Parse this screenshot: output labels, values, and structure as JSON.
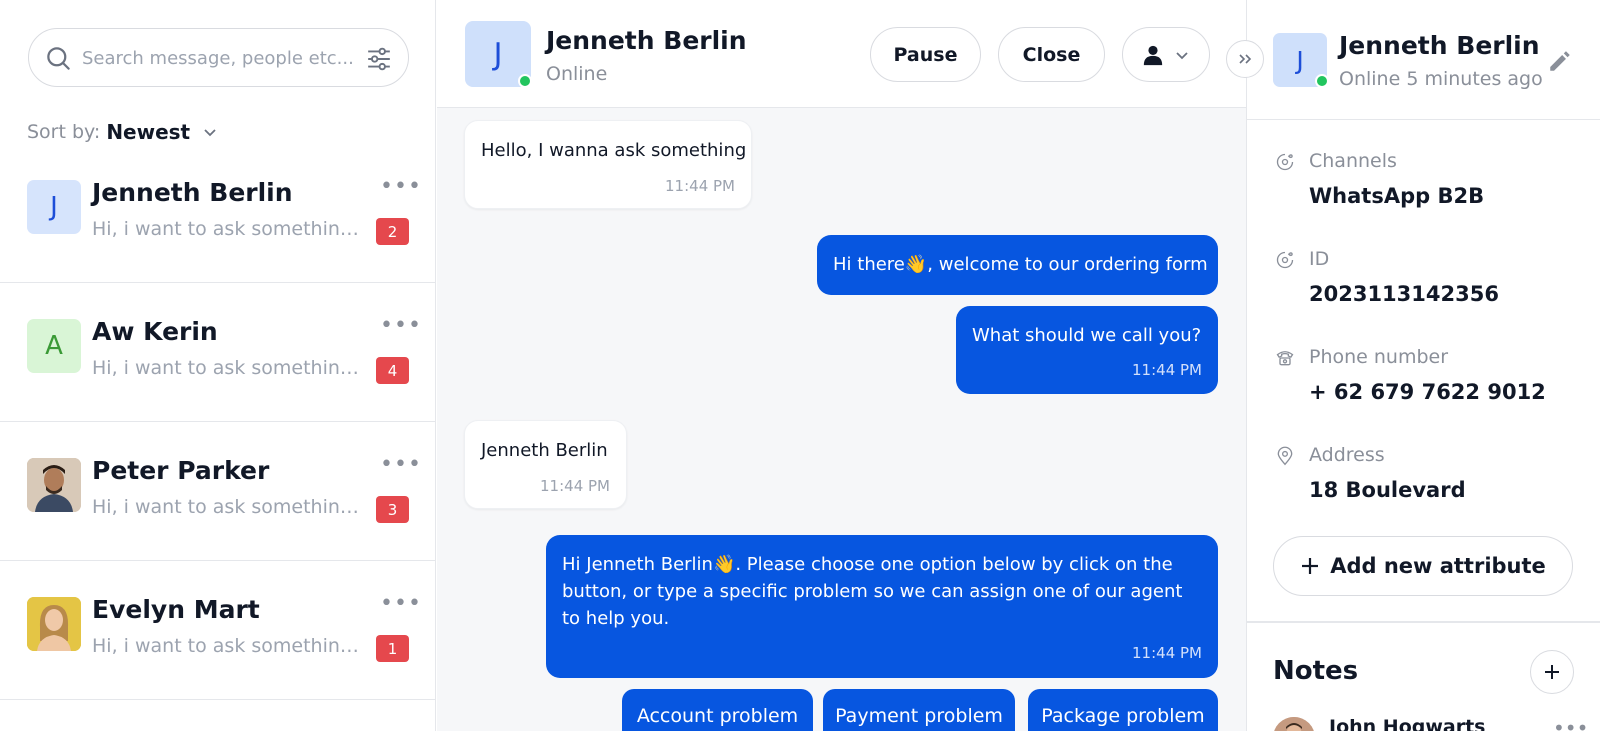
{
  "search": {
    "placeholder": "Search message, people etc..."
  },
  "sort": {
    "label": "Sort by:",
    "value": "Newest"
  },
  "conversations": [
    {
      "name": "Jenneth Berlin",
      "initial": "J",
      "preview": "Hi, i want to ask something t...",
      "unread": "2",
      "avatar_bg": "#d6e4fc",
      "avatar_fg": "#1d4ed8"
    },
    {
      "name": "Aw Kerin",
      "initial": "A",
      "preview": "Hi, i want to ask something t...",
      "unread": "4",
      "avatar_bg": "#d9f5d6",
      "avatar_fg": "#3a9a36"
    },
    {
      "name": "Peter Parker",
      "preview": "Hi, i want to ask something t...",
      "unread": "3"
    },
    {
      "name": "Evelyn Mart",
      "preview": "Hi, i want to ask something t...",
      "unread": "1"
    }
  ],
  "chat": {
    "contact_initial": "J",
    "contact_name": "Jenneth Berlin",
    "status": "Online",
    "pause_label": "Pause",
    "close_label": "Close",
    "messages": [
      {
        "direction": "in",
        "text": "Hello, I wanna ask something",
        "time": "11:44 PM"
      },
      {
        "direction": "out",
        "text": "Hi there👋, welcome to our ordering form"
      },
      {
        "direction": "out",
        "text": "What should we call you?",
        "time": "11:44 PM"
      },
      {
        "direction": "in",
        "text": "Jenneth Berlin",
        "time": "11:44 PM"
      },
      {
        "direction": "out",
        "text": "Hi Jenneth Berlin👋. Please choose one option below by click on the button, or type a specific problem so we can assign one of our agent to help you.",
        "time": "11:44 PM"
      }
    ],
    "quick_replies": [
      "Account problem",
      "Payment problem",
      "Package problem"
    ]
  },
  "profile": {
    "initial": "J",
    "name": "Jenneth Berlin",
    "status": "Online 5 minutes ago",
    "attributes": [
      {
        "label": "Channels",
        "value": "WhatsApp B2B",
        "icon": "channels-icon"
      },
      {
        "label": "ID",
        "value": "2023113142356",
        "icon": "id-icon"
      },
      {
        "label": "Phone number",
        "value": "+ 62 679 7622 9012",
        "icon": "phone-icon"
      },
      {
        "label": "Address",
        "value": "18 Boulevard",
        "icon": "location-icon"
      }
    ],
    "add_attribute_label": "Add new attribute"
  },
  "notes": {
    "title": "Notes",
    "first_author": "John Hogwarts"
  },
  "colors": {
    "accent": "#0756e0",
    "badge": "#e5484d",
    "online": "#22c55e"
  }
}
